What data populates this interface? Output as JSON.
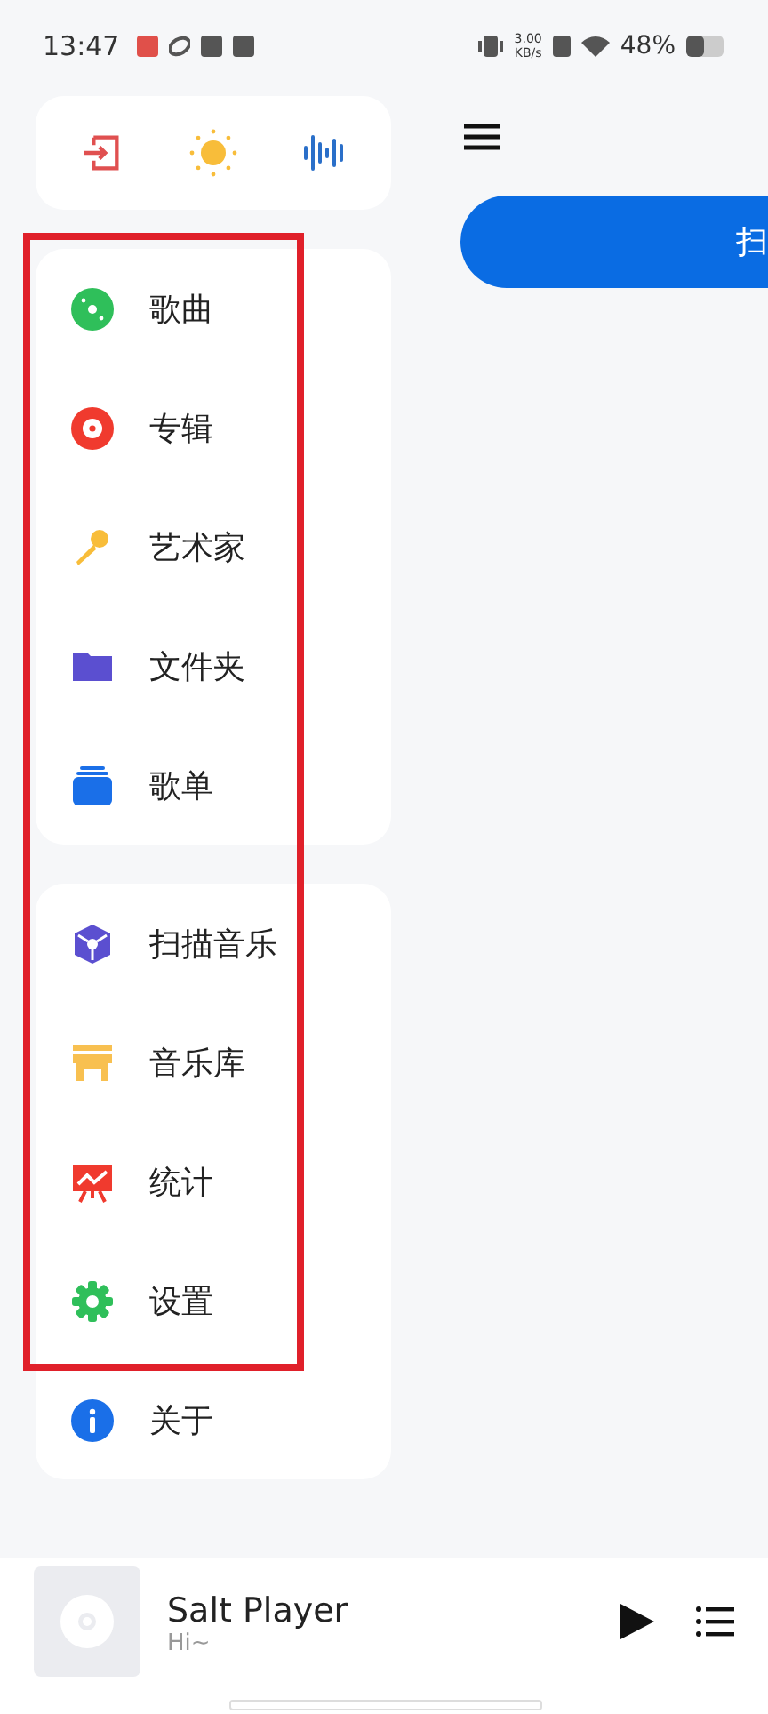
{
  "status_bar": {
    "time": "13:47",
    "speed_value": "3.00",
    "speed_unit": "KB/s",
    "battery": "48%"
  },
  "quick_actions": [
    {
      "kind": "exit"
    },
    {
      "kind": "sun"
    },
    {
      "kind": "wave"
    }
  ],
  "menu_groups": [
    {
      "items": [
        {
          "label": "歌曲",
          "kind": "disc"
        },
        {
          "label": "专辑",
          "kind": "album"
        },
        {
          "label": "艺术家",
          "kind": "mic"
        },
        {
          "label": "文件夹",
          "kind": "folder"
        },
        {
          "label": "歌单",
          "kind": "playlist"
        }
      ]
    },
    {
      "items": [
        {
          "label": "扫描音乐",
          "kind": "scan"
        },
        {
          "label": "音乐库",
          "kind": "store"
        },
        {
          "label": "统计",
          "kind": "stats"
        },
        {
          "label": "设置",
          "kind": "gear"
        },
        {
          "label": "关于",
          "kind": "info"
        }
      ]
    }
  ],
  "main": {
    "scan_button": "扫"
  },
  "player": {
    "title": "Salt Player",
    "subtitle": "Hi~"
  }
}
